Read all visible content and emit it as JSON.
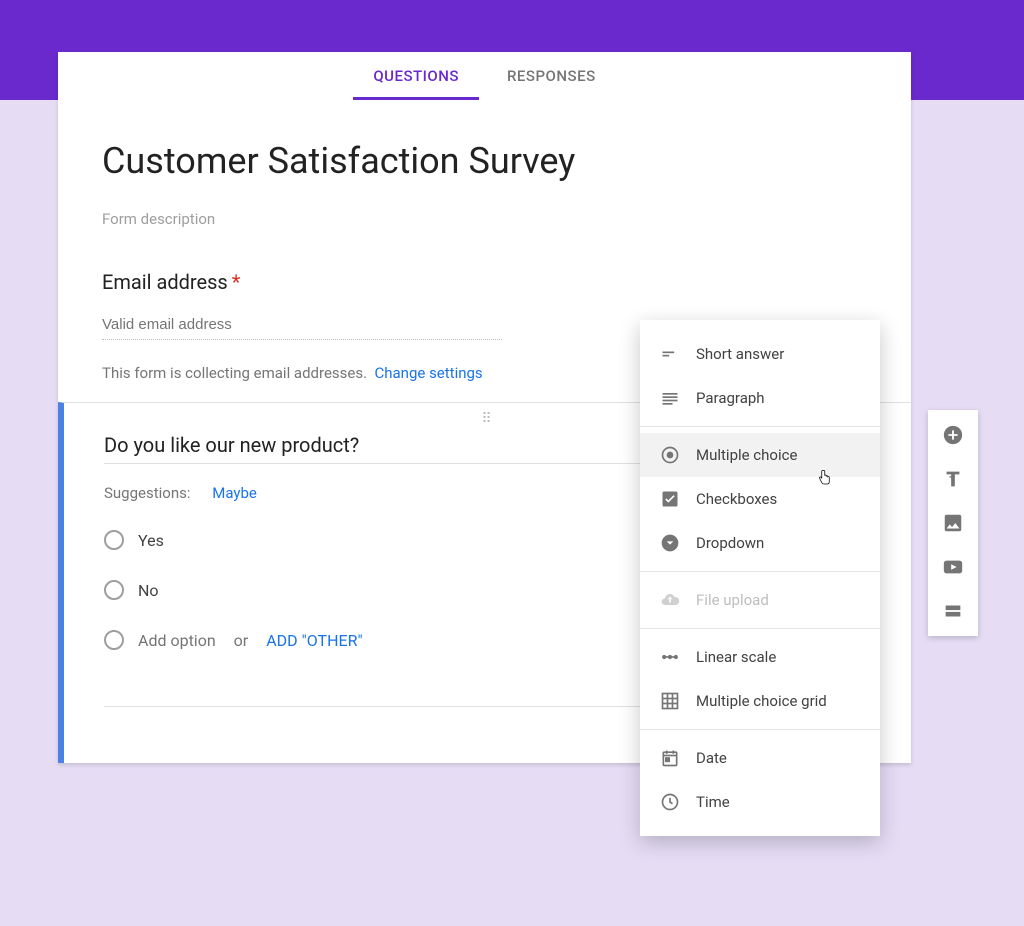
{
  "tabs": {
    "questions": "QUESTIONS",
    "responses": "RESPONSES"
  },
  "header": {
    "title": "Customer Satisfaction Survey",
    "description_placeholder": "Form description",
    "email_label": "Email address",
    "email_placeholder": "Valid email address",
    "email_note": "This form is collecting email addresses.",
    "change_settings": "Change settings"
  },
  "question": {
    "title": "Do you like our new product?",
    "suggestions_label": "Suggestions:",
    "suggestion": "Maybe",
    "options": [
      "Yes",
      "No"
    ],
    "add_option": "Add option",
    "or": "or",
    "add_other": "ADD \"OTHER\""
  },
  "popover": {
    "short_answer": "Short answer",
    "paragraph": "Paragraph",
    "multiple_choice": "Multiple choice",
    "checkboxes": "Checkboxes",
    "dropdown": "Dropdown",
    "file_upload": "File upload",
    "linear_scale": "Linear scale",
    "grid": "Multiple choice grid",
    "date": "Date",
    "time": "Time"
  },
  "colors": {
    "accent": "#6a29cc",
    "link": "#1a73e8"
  }
}
